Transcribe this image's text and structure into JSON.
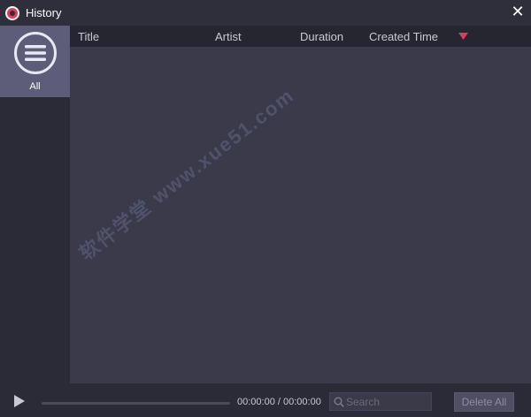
{
  "window": {
    "title": "History",
    "close_label": "✕"
  },
  "sidebar": {
    "items": [
      {
        "label": "All",
        "icon": "list-icon",
        "selected": true
      }
    ]
  },
  "table": {
    "columns": [
      "Title",
      "Artist",
      "Duration",
      "Created Time"
    ],
    "sort_icon": "sort-desc-icon",
    "rows": []
  },
  "player": {
    "time": "00:00:00 / 00:00:00",
    "progress": 0
  },
  "search": {
    "placeholder": "Search"
  },
  "actions": {
    "delete_all_label": "Delete All"
  },
  "watermark": {
    "text": "软件学堂 www.xue51.com"
  },
  "colors": {
    "accent": "#e23a5b",
    "selected": "#5e5d79",
    "background": "#3a3a4a"
  }
}
